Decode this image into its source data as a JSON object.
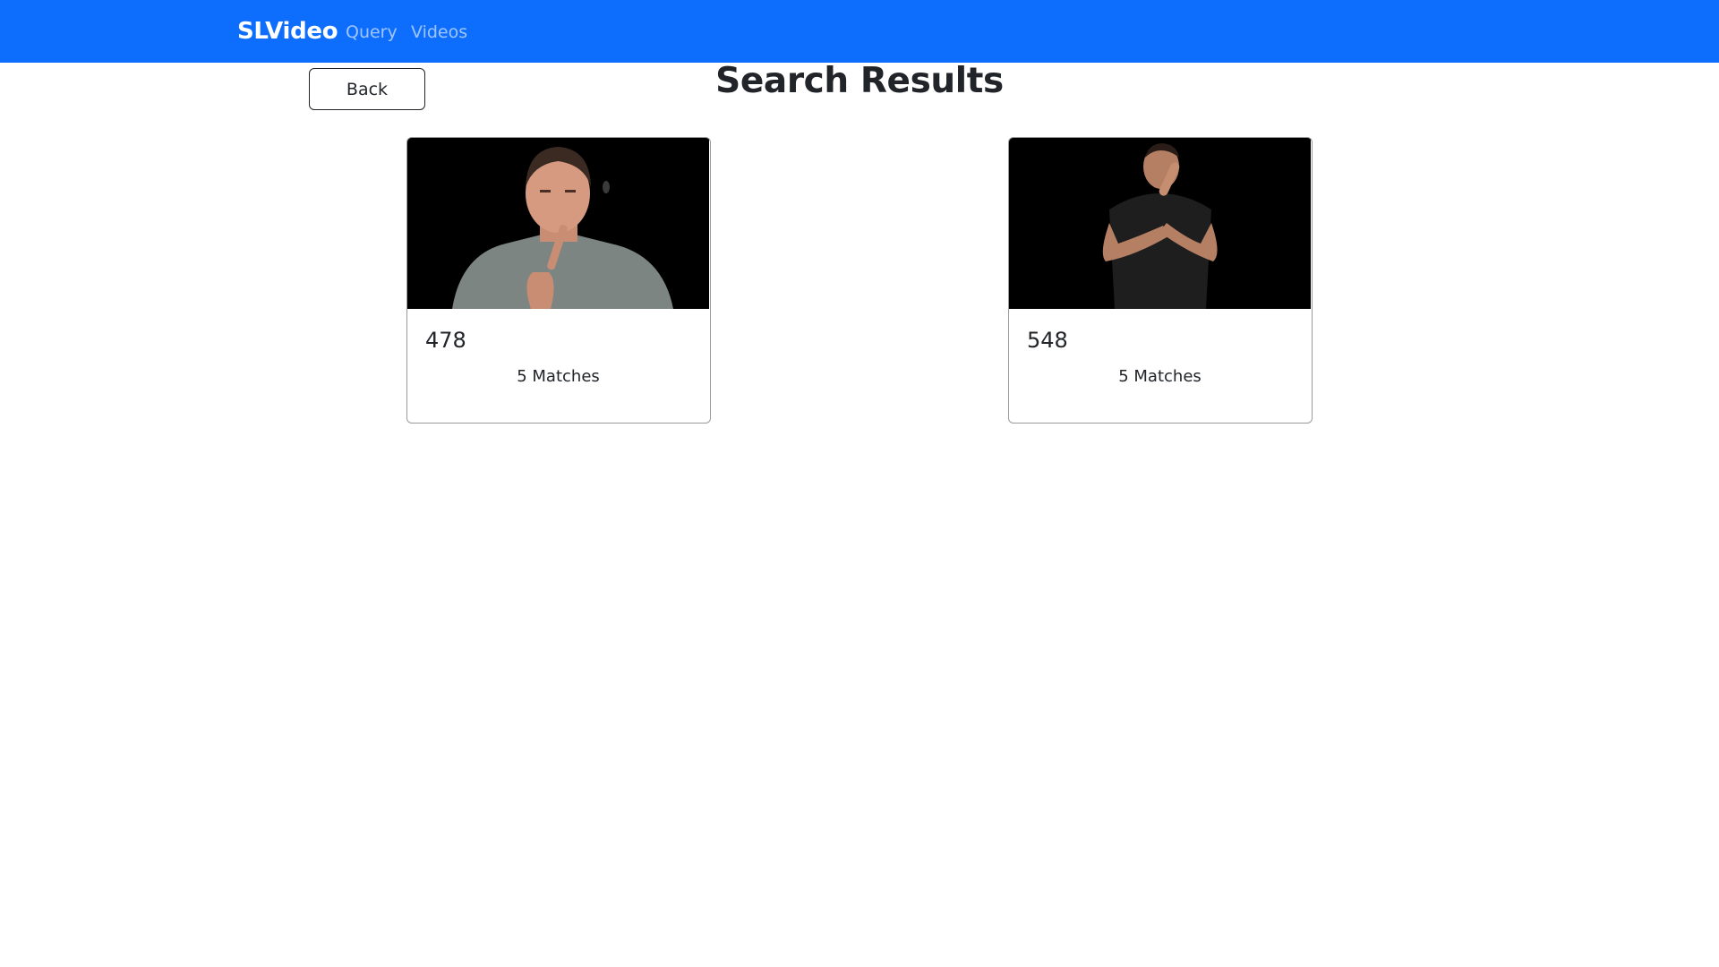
{
  "navbar": {
    "brand": "SLVideo",
    "links": [
      "Query",
      "Videos"
    ],
    "background": "#0d6efd"
  },
  "page": {
    "back_label": "Back",
    "title": "Search Results"
  },
  "results": [
    {
      "title": "478",
      "matches": "5 Matches"
    },
    {
      "title": "548",
      "matches": "5 Matches"
    }
  ]
}
